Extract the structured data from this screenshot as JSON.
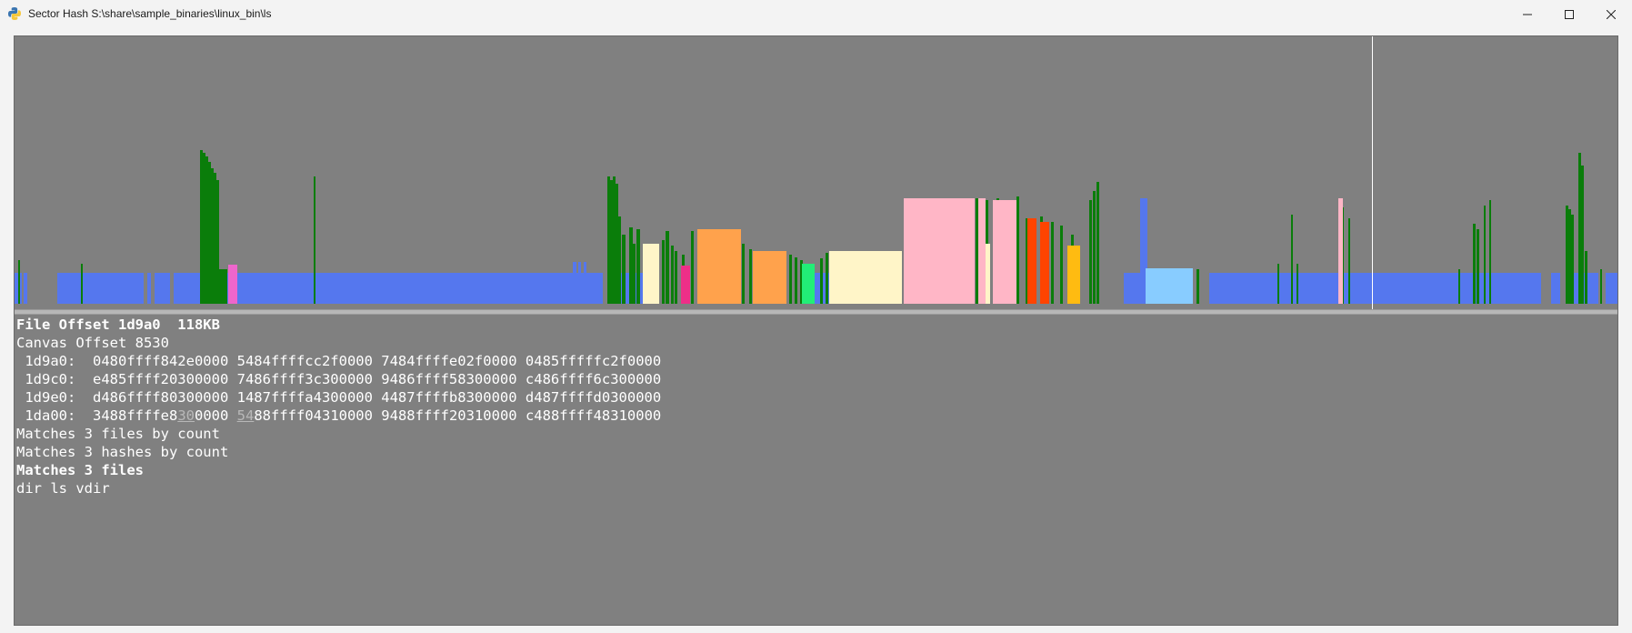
{
  "window": {
    "title": "Sector Hash S:\\share\\sample_binaries\\linux_bin\\ls",
    "app_icon": "python-icon",
    "controls": [
      "minimize",
      "maximize",
      "close"
    ]
  },
  "colors": {
    "background": "#808080",
    "blue": "#5577ee",
    "green": "#0a7d0a",
    "pink": "#ffb6c6",
    "orange": "#ffa24c",
    "cream": "#fff5c8",
    "light_blue": "#88ccff"
  },
  "info": {
    "file_offset": "File Offset 1d9a0  118KB",
    "canvas_offset": "Canvas Offset 8530",
    "hex_rows": [
      {
        "text": " 1d9a0:  0480ffff842e0000 5484ffffcc2f0000 7484ffffe02f0000 0485fffffc2f0000"
      },
      {
        "text": " 1d9c0:  e485ffff20300000 7486ffff3c300000 9486ffff58300000 c486ffff6c300000"
      },
      {
        "text": " 1d9e0:  d486ffff80300000 1487ffffa4300000 4487ffffb8300000 d487ffffd0300000"
      },
      {
        "pre": " 1da00:  3488ffffe8",
        "hl1": "30",
        "mid": "0000 ",
        "hl2": "54",
        "post": "88ffff04310000 9488ffff20310000 c488ffff48310000"
      }
    ],
    "match_files_count": "Matches 3 files by count",
    "match_hashes_count": "Matches 3 hashes by count",
    "match_files": "Matches 3 files",
    "file_list": "dir ls vdir"
  }
}
